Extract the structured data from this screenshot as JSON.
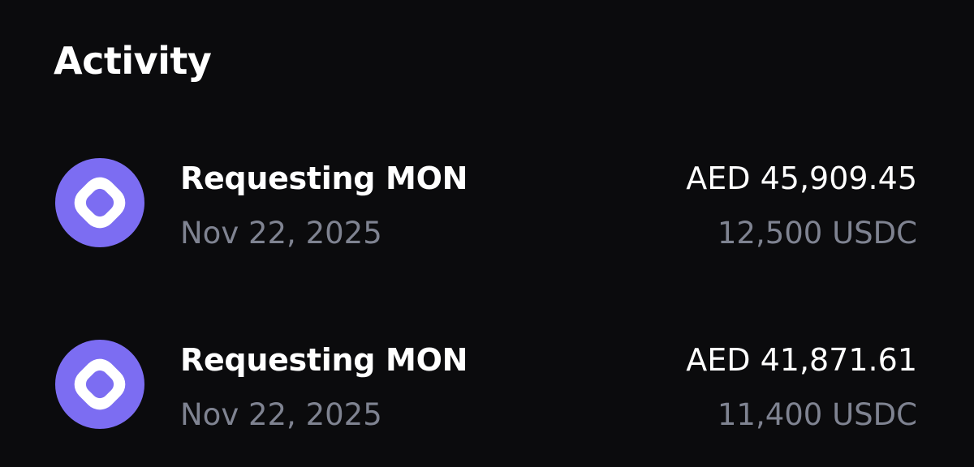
{
  "header": {
    "title": "Activity"
  },
  "colors": {
    "background": "#0b0b0d",
    "primary_text": "#ffffff",
    "secondary_text": "#7f8391",
    "token_accent": "#7c6df2"
  },
  "activity": {
    "items": [
      {
        "icon": "monad-token-icon",
        "title": "Requesting MON",
        "date": "Nov 22, 2025",
        "fiat_amount": "AED 45,909.45",
        "crypto_amount": "12,500 USDC"
      },
      {
        "icon": "monad-token-icon",
        "title": "Requesting MON",
        "date": "Nov 22, 2025",
        "fiat_amount": "AED 41,871.61",
        "crypto_amount": "11,400 USDC"
      }
    ]
  }
}
